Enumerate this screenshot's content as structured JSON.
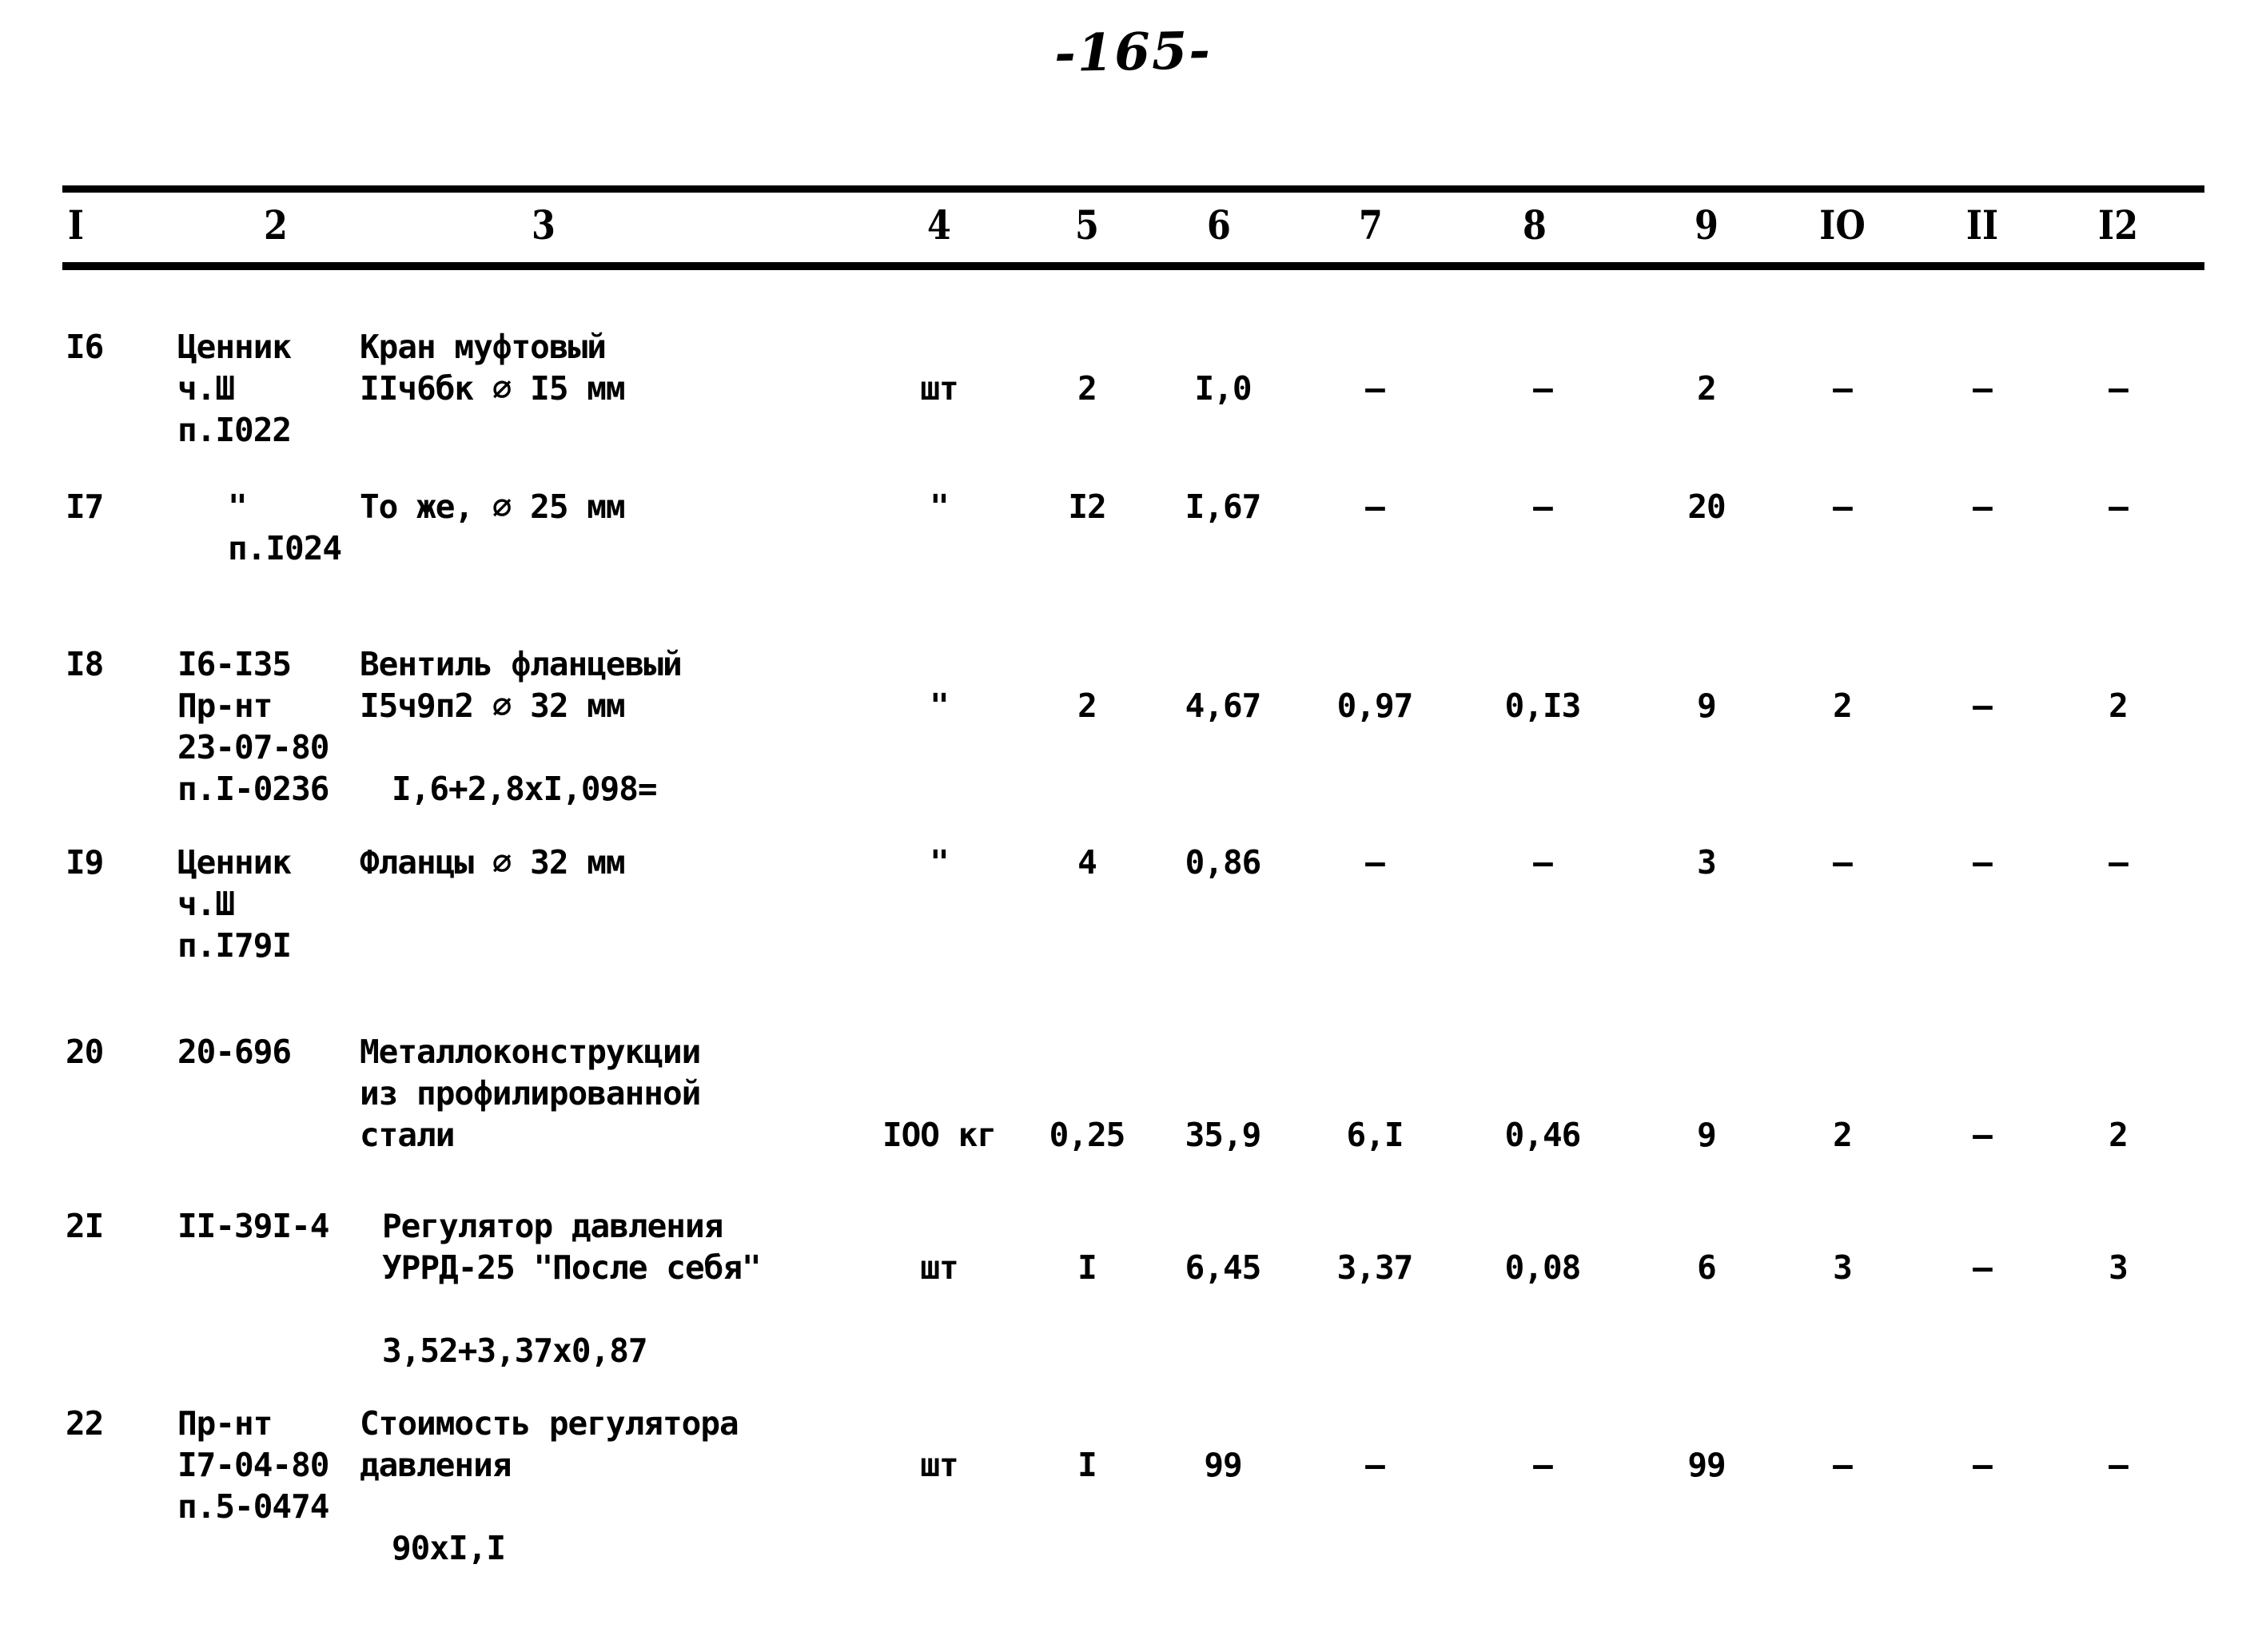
{
  "page": {
    "number_label": "-165-"
  },
  "table": {
    "column_headers": [
      "I",
      "2",
      "3",
      "4",
      "5",
      "6",
      "7",
      "8",
      "9",
      "IO",
      "II",
      "I2"
    ],
    "rows": [
      {
        "num": "I6",
        "code": "Ценник\nч.Ш\nп.I022",
        "description": "Кран муфтовый\nIIч6бк ⌀ I5 мм",
        "formula": "",
        "unit": "шт",
        "qty": "2",
        "c6": "I,0",
        "c7": "–",
        "c8": "–",
        "c9": "2",
        "c10": "–",
        "c11": "–",
        "c12": "–"
      },
      {
        "num": "I7",
        "code": "\"\nп.I024",
        "description": "То же, ⌀ 25 мм",
        "formula": "",
        "unit": "\"",
        "qty": "I2",
        "c6": "I,67",
        "c7": "–",
        "c8": "–",
        "c9": "20",
        "c10": "–",
        "c11": "–",
        "c12": "–"
      },
      {
        "num": "I8",
        "code": "I6-I35\nПр-нт\n23-07-80\nп.I-0236",
        "description": "Вентиль фланцевый\nI5ч9п2 ⌀ 32 мм",
        "formula": "I,6+2,8xI,098=",
        "unit": "\"",
        "qty": "2",
        "c6": "4,67",
        "c7": "0,97",
        "c8": "0,I3",
        "c9": "9",
        "c10": "2",
        "c11": "–",
        "c12": "2"
      },
      {
        "num": "I9",
        "code": "Ценник\nч.Ш\nп.I79I",
        "description": "Фланцы ⌀ 32 мм",
        "formula": "",
        "unit": "\"",
        "qty": "4",
        "c6": "0,86",
        "c7": "–",
        "c8": "–",
        "c9": "3",
        "c10": "–",
        "c11": "–",
        "c12": "–"
      },
      {
        "num": "20",
        "code": "20-696",
        "description": "Металлоконструкции\nиз профилированной\nстали",
        "formula": "",
        "unit": "IOO кг",
        "qty": "0,25",
        "c6": "35,9",
        "c7": "6,I",
        "c8": "0,46",
        "c9": "9",
        "c10": "2",
        "c11": "–",
        "c12": "2"
      },
      {
        "num": "2I",
        "code": "II-39I-4",
        "description": "Регулятор давления\nУРРД-25 \"После себя\"",
        "formula": "3,52+3,37x0,87",
        "unit": "шт",
        "qty": "I",
        "c6": "6,45",
        "c7": "3,37",
        "c8": "0,08",
        "c9": "6",
        "c10": "3",
        "c11": "–",
        "c12": "3"
      },
      {
        "num": "22",
        "code": "Пр-нт\nI7-04-80\nп.5-0474",
        "description": "Стоимость регулятора\nдавления",
        "formula": "90xI,I",
        "unit": "шт",
        "qty": "I",
        "c6": "99",
        "c7": "–",
        "c8": "–",
        "c9": "99",
        "c10": "–",
        "c11": "–",
        "c12": "–"
      }
    ]
  }
}
